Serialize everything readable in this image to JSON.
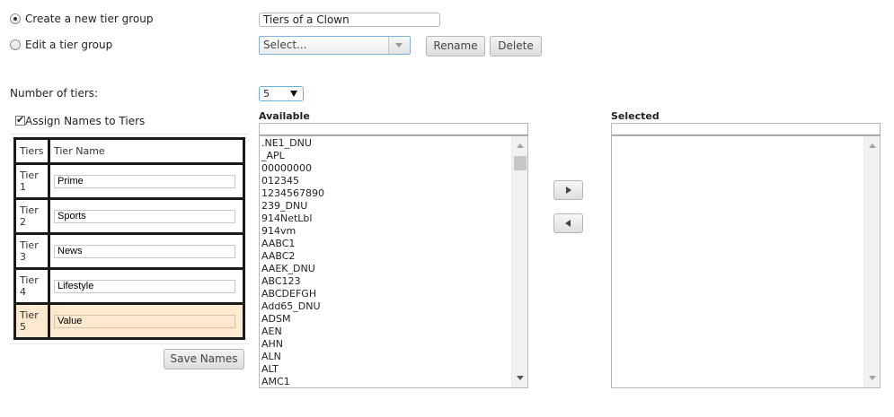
{
  "mode": {
    "create_label": "Create a new tier group",
    "edit_label": "Edit a tier group"
  },
  "group_name_value": "Tiers of a Clown",
  "edit_select_value": "Select...",
  "rename_label": "Rename",
  "delete_label": "Delete",
  "num_tiers_label": "Number of tiers:",
  "num_tiers_value": "5",
  "assign_names_label": "Assign Names to Tiers",
  "table": {
    "col_tiers": "Tiers",
    "col_name": "Tier Name",
    "rows": [
      {
        "word": "Tier",
        "num": "1",
        "name": "Prime"
      },
      {
        "word": "Tier",
        "num": "2",
        "name": "Sports"
      },
      {
        "word": "Tier",
        "num": "3",
        "name": "News"
      },
      {
        "word": "Tier",
        "num": "4",
        "name": "Lifestyle"
      },
      {
        "word": "Tier",
        "num": "5",
        "name": "Value"
      }
    ]
  },
  "save_names_label": "Save Names",
  "available": {
    "label": "Available",
    "items": [
      ".NE1_DNU",
      "_APL",
      "00000000",
      "012345",
      "1234567890",
      "239_DNU",
      "914NetLbl",
      "914vm",
      "AABC1",
      "AABC2",
      "AAEK_DNU",
      "ABC123",
      "ABCDEFGH",
      "Add65_DNU",
      "ADSM",
      "AEN",
      "AHN",
      "ALN",
      "ALT",
      "AMC1"
    ]
  },
  "selected": {
    "label": "Selected"
  },
  "colors": {
    "highlight_row": "#fde9cf",
    "accent_border": "#7fb2d6"
  }
}
